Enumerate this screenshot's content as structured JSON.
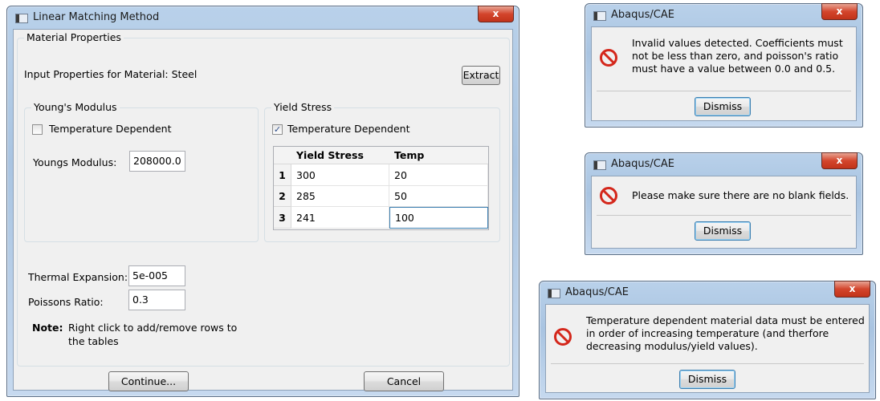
{
  "main_dialog": {
    "title": "Linear Matching Method",
    "close_glyph": "x",
    "section_title": "Material Properties",
    "input_label": "Input Properties for Material: Steel",
    "extract_label": "Extract",
    "youngs": {
      "group_title": "Young's Modulus",
      "temp_dep_label": "Temperature Dependent",
      "temp_dep_checked": false,
      "modulus_label": "Youngs Modulus:",
      "modulus_value": "208000.0"
    },
    "yield": {
      "group_title": "Yield Stress",
      "temp_dep_label": "Temperature Dependent",
      "temp_dep_checked": true,
      "check_glyph": "✓",
      "columns": [
        "Yield Stress",
        "Temp"
      ],
      "rows": [
        {
          "n": "1",
          "stress": "300",
          "temp": "20"
        },
        {
          "n": "2",
          "stress": "285",
          "temp": "50"
        },
        {
          "n": "3",
          "stress": "241",
          "temp": "100"
        }
      ]
    },
    "thermal_label": "Thermal Expansion:",
    "thermal_value": "5e-005",
    "poisson_label": "Poissons Ratio:",
    "poisson_value": "0.3",
    "note_bold": "Note:",
    "note_line1": "Right click to add/remove rows to",
    "note_line2": "the tables",
    "continue_label": "Continue...",
    "cancel_label": "Cancel"
  },
  "alerts": [
    {
      "title": "Abaqus/CAE",
      "lines": [
        "Invalid values detected. Coefficients must",
        "not be less than zero, and poisson's ratio",
        "must have a value between 0.0 and 0.5."
      ],
      "button": "Dismiss"
    },
    {
      "title": "Abaqus/CAE",
      "lines": [
        "Please make sure there are no blank fields."
      ],
      "button": "Dismiss"
    },
    {
      "title": "Abaqus/CAE",
      "lines": [
        "Temperature dependent material data must be entered",
        "in order of increasing temperature (and therfore",
        "decreasing modulus/yield values)."
      ],
      "button": "Dismiss"
    }
  ],
  "colors": {
    "error_red": "#d4271b",
    "default_button_border": "#3c7fb1"
  }
}
